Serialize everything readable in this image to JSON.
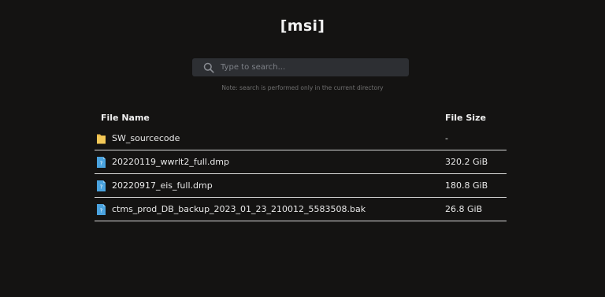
{
  "page": {
    "title": "[msi]"
  },
  "search": {
    "placeholder": "Type to search...",
    "value": "",
    "note": "Note: search is performed only in the current directory"
  },
  "table": {
    "headers": {
      "name": "File Name",
      "size": "File Size"
    },
    "rows": [
      {
        "name": "SW_sourcecode",
        "size": "-",
        "icon": "folder-icon"
      },
      {
        "name": "20220119_wwrlt2_full.dmp",
        "size": "320.2 GiB",
        "icon": "file-icon"
      },
      {
        "name": "20220917_eis_full.dmp",
        "size": "180.8 GiB",
        "icon": "file-icon"
      },
      {
        "name": "ctms_prod_DB_backup_2023_01_23_210012_5583508.bak",
        "size": "26.8 GiB",
        "icon": "file-icon"
      }
    ]
  },
  "colors": {
    "background": "#141312",
    "folder": "#e9b949",
    "file": "#4aa3df",
    "search_bg": "#2d2f33"
  }
}
